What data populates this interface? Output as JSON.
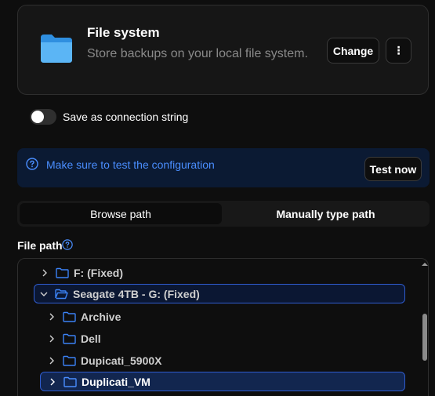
{
  "destination": {
    "title": "File system",
    "description": "Store backups on your local file system.",
    "change_label": "Change",
    "more_label": "⋮",
    "icon": "folder-icon"
  },
  "connection_string": {
    "label": "Save as connection string",
    "enabled": false
  },
  "info": {
    "message": "Make sure to test the configuration",
    "test_label": "Test now",
    "icon": "help-circle-icon"
  },
  "mode_tabs": {
    "browse_label": "Browse path",
    "manual_label": "Manually type path",
    "selected": "browse"
  },
  "file_path": {
    "label": "File path",
    "help_icon": "help-circle-icon"
  },
  "tree": {
    "items": [
      {
        "label": "F: (Fixed)",
        "expanded": false,
        "level": 0
      },
      {
        "label": "Seagate 4TB - G: (Fixed)",
        "expanded": true,
        "level": 0
      },
      {
        "label": "Archive",
        "expanded": false,
        "level": 1
      },
      {
        "label": "Dell",
        "expanded": false,
        "level": 1
      },
      {
        "label": "Dupicati_5900X",
        "expanded": false,
        "level": 1
      },
      {
        "label": "Duplicati_VM",
        "expanded": false,
        "level": 1,
        "selected": true
      }
    ]
  },
  "colors": {
    "accent": "#4a8eff",
    "folder_blue": "#3b82f6",
    "background": "#0e0e0e"
  }
}
